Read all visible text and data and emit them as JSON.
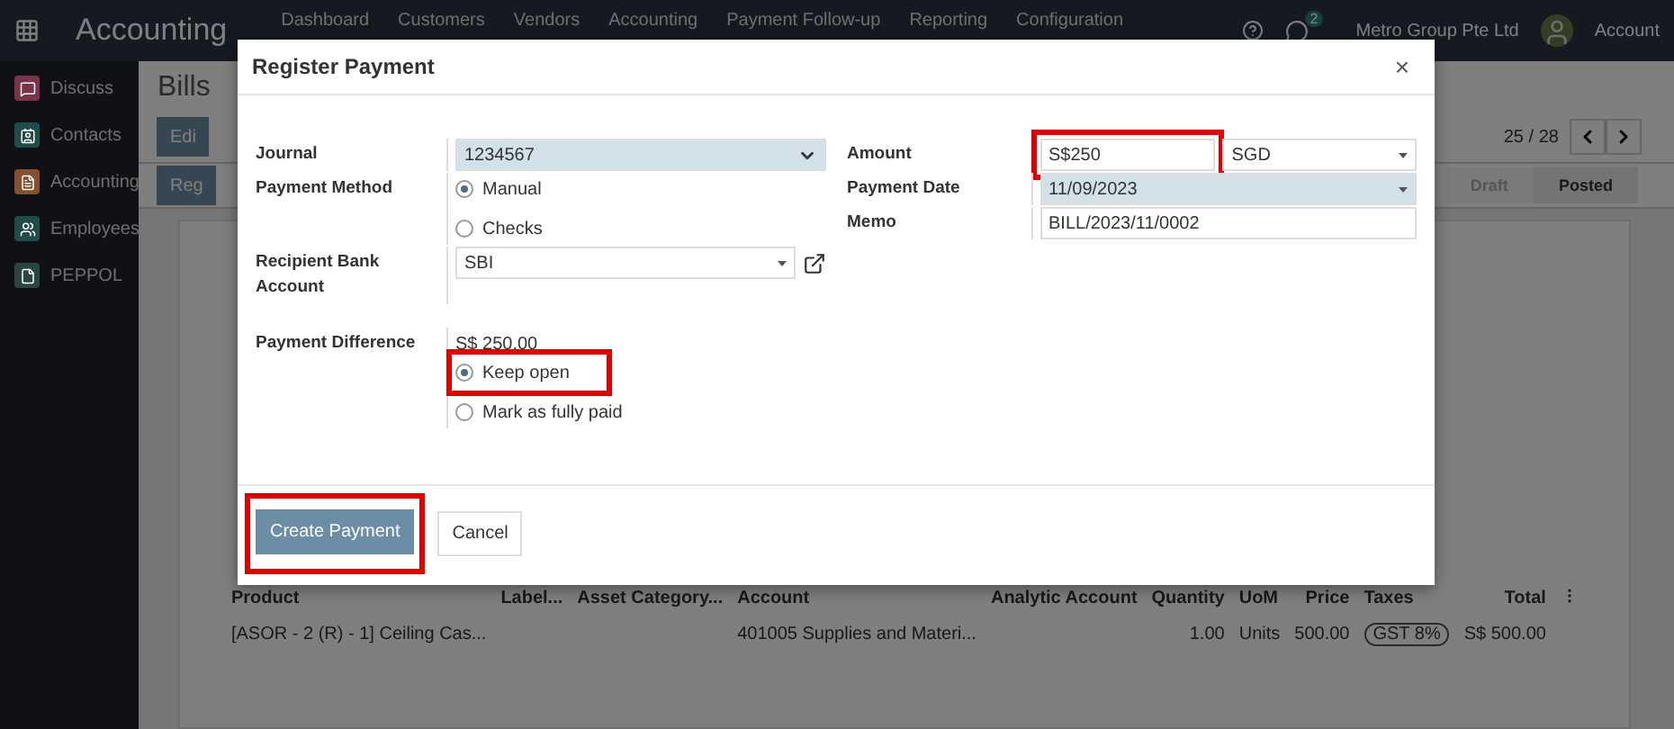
{
  "app_bar": {
    "title": "Accounting",
    "menu": [
      "Dashboard",
      "Customers",
      "Vendors",
      "Accounting",
      "Payment Follow-up",
      "Reporting",
      "Configuration"
    ],
    "notification_count": "2",
    "company": "Metro Group Pte Ltd",
    "user": "Account"
  },
  "sidebar": {
    "items": [
      {
        "label": "Discuss",
        "kind": "chat",
        "color": "#7a3447"
      },
      {
        "label": "Contacts",
        "kind": "contact",
        "color": "#224c49"
      },
      {
        "label": "Accounting",
        "kind": "invoice",
        "color": "#85502b"
      },
      {
        "label": "Employees",
        "kind": "people",
        "color": "#224c49"
      },
      {
        "label": "PEPPOL",
        "kind": "document",
        "color": "#2b4640"
      }
    ]
  },
  "record": {
    "breadcrumb": "Bills",
    "edit_button": "Edi",
    "register_button": "Reg",
    "pager": "25 / 28",
    "status_steps": [
      {
        "label": "Draft",
        "selected": false
      },
      {
        "label": "Posted",
        "selected": true
      }
    ],
    "table": {
      "columns": [
        "Product",
        "Label...",
        "Asset Category...",
        "Account",
        "Analytic Account",
        "Quantity",
        "UoM",
        "Price",
        "Taxes",
        "Total"
      ],
      "rows": [
        [
          "[ASOR - 2 (R) - 1] Ceiling Cas...",
          "",
          "",
          "401005 Supplies and Materi...",
          "",
          "1.00",
          "Units",
          "500.00",
          "GST 8%",
          "S$ 500.00"
        ]
      ]
    }
  },
  "dialog": {
    "title": "Register Payment",
    "close": "×",
    "left_fields": [
      {
        "kind": "select",
        "label": "Journal",
        "value": "1234567",
        "required": true
      },
      {
        "kind": "radio",
        "label": "Payment Method",
        "options": [
          {
            "label": "Manual",
            "selected": true,
            "highlighted": false
          },
          {
            "label": "Checks",
            "selected": false,
            "highlighted": false
          }
        ]
      },
      {
        "kind": "many2one",
        "label": "Recipient Bank Account",
        "value": "SBI",
        "required": false
      }
    ],
    "right_fields": [
      {
        "kind": "amount",
        "label": "Amount",
        "value": "S$250",
        "currency": "SGD",
        "highlighted": true
      },
      {
        "kind": "many2one",
        "label": "Payment Date",
        "value": "11/09/2023",
        "required": true
      },
      {
        "kind": "text",
        "label": "Memo",
        "value": "BILL/2023/11/0002"
      }
    ],
    "payment_difference": {
      "label": "Payment Difference",
      "amount": "S$ 250.00",
      "options": [
        {
          "label": "Keep open",
          "selected": true,
          "highlighted": true
        },
        {
          "label": "Mark as fully paid",
          "selected": false,
          "highlighted": false
        }
      ]
    },
    "buttons": [
      {
        "label": "Create Payment",
        "kind": "primary",
        "highlighted": true
      },
      {
        "label": "Cancel",
        "kind": "secondary",
        "highlighted": false
      }
    ]
  }
}
